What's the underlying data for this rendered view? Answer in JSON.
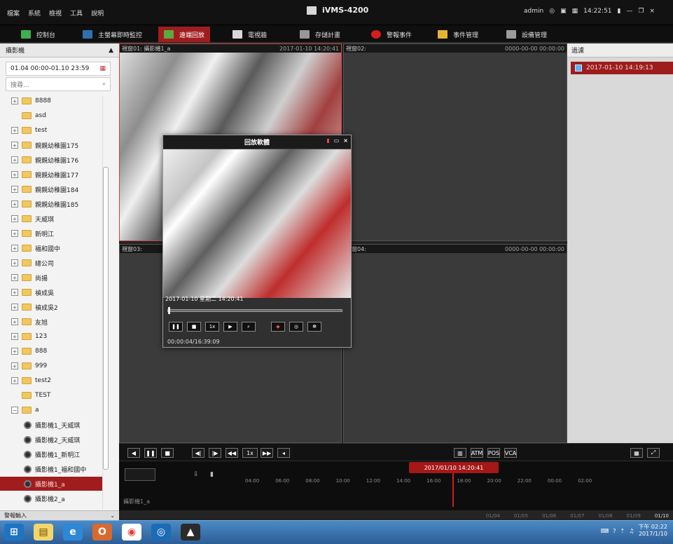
{
  "titlebar": {
    "menu": [
      "檔案",
      "系統",
      "檢視",
      "工具",
      "說明"
    ],
    "app_title": "iVMS-4200",
    "user": "admin",
    "time": "14:22:51"
  },
  "nav": [
    {
      "label": "控制台"
    },
    {
      "label": "主螢幕即時監控"
    },
    {
      "label": "遠端回放"
    },
    {
      "label": "電視牆"
    },
    {
      "label": "存儲計畫"
    },
    {
      "label": "警報事件"
    },
    {
      "label": "事件管理"
    },
    {
      "label": "設備管理"
    }
  ],
  "left_panel": {
    "title": "攝影機",
    "date_range": "01.04 00:00-01.10 23:59",
    "search_placeholder": "搜尋...",
    "tree": [
      {
        "label": "8888",
        "expand": true,
        "type": "folder"
      },
      {
        "label": "asd",
        "expand": false,
        "type": "folder"
      },
      {
        "label": "test",
        "expand": true,
        "type": "folder"
      },
      {
        "label": "親親幼稚園175",
        "expand": true,
        "type": "folder"
      },
      {
        "label": "親親幼稚園176",
        "expand": true,
        "type": "folder"
      },
      {
        "label": "親親幼稚園177",
        "expand": true,
        "type": "folder"
      },
      {
        "label": "親親幼稚園184",
        "expand": true,
        "type": "folder"
      },
      {
        "label": "親親幼稚園185",
        "expand": true,
        "type": "folder"
      },
      {
        "label": "天威琪",
        "expand": true,
        "type": "folder"
      },
      {
        "label": "新明江",
        "expand": true,
        "type": "folder"
      },
      {
        "label": "福和國中",
        "expand": true,
        "type": "folder"
      },
      {
        "label": "總公司",
        "expand": true,
        "type": "folder"
      },
      {
        "label": "尚揚",
        "expand": true,
        "type": "folder"
      },
      {
        "label": "禎成吳",
        "expand": true,
        "type": "folder"
      },
      {
        "label": "禎成吳2",
        "expand": true,
        "type": "folder"
      },
      {
        "label": "友旭",
        "expand": true,
        "type": "folder"
      },
      {
        "label": "123",
        "expand": true,
        "type": "folder"
      },
      {
        "label": "888",
        "expand": true,
        "type": "folder"
      },
      {
        "label": "999",
        "expand": true,
        "type": "folder"
      },
      {
        "label": "test2",
        "expand": true,
        "type": "folder"
      },
      {
        "label": "TEST",
        "expand": false,
        "type": "folder"
      },
      {
        "label": "a",
        "expand": true,
        "type": "folder",
        "open": true
      },
      {
        "label": "攝影機1_天威琪",
        "type": "camera"
      },
      {
        "label": "攝影機2_天威琪",
        "type": "camera"
      },
      {
        "label": "攝影機1_新明江",
        "type": "camera"
      },
      {
        "label": "攝影機1_福和國中",
        "type": "camera"
      },
      {
        "label": "攝影機1_a",
        "type": "camera",
        "selected": true
      },
      {
        "label": "攝影機2_a",
        "type": "camera"
      }
    ],
    "alarm_input": "警報輸入"
  },
  "panes": [
    {
      "name": "視窗01: 攝影機1_a",
      "time": "2017-01-10 14:20:41"
    },
    {
      "name": "視窗02:",
      "time": "0000-00-00 00:00:00"
    },
    {
      "name": "視窗03:",
      "time": ""
    },
    {
      "name": "視窗04:",
      "time": "0000-00-00 00:00:00"
    }
  ],
  "popup": {
    "title": "回放軟體",
    "small_time": "2017-01-10 星期二 14:20:41",
    "status": "00:00:04/16:39:09",
    "speed": "1x"
  },
  "right_panel": {
    "title": "過濾",
    "record_time": "2017-01-10 14:19:13"
  },
  "controls": {
    "speed": "1x"
  },
  "timeline": {
    "badge": "2017/01/10 14:20:41",
    "camera_label": "攝影機1_a",
    "hour_ticks": [
      "04:00",
      "06:00",
      "08:00",
      "10:00",
      "12:00",
      "14:00",
      "16:00",
      "18:00",
      "20:00",
      "22:00",
      "00:00",
      "02:00"
    ],
    "date_ticks": [
      "01/04",
      "01/05",
      "01/06",
      "01/07",
      "01/08",
      "01/09",
      "01/10"
    ]
  },
  "taskbar": {
    "time": "下午 02:22",
    "date": "2017/1/10"
  },
  "colors": {
    "accent": "#a11d1d",
    "dark": "#121212",
    "panel": "#f3f3f3"
  }
}
